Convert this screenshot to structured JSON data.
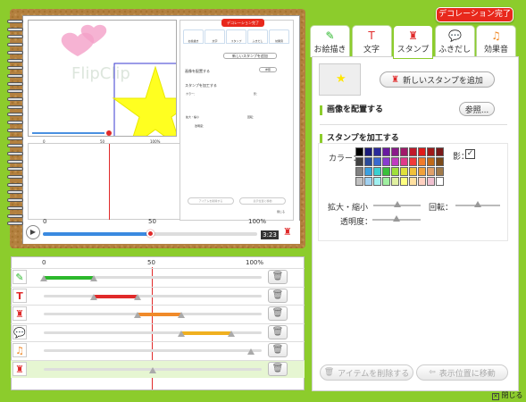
{
  "header": {
    "done_label": "デコレーション完了"
  },
  "preview": {
    "watermark": "FlipClip"
  },
  "tabs": [
    {
      "label": "お絵描き",
      "icon": "pencil-icon"
    },
    {
      "label": "文字",
      "icon": "text-t-icon"
    },
    {
      "label": "スタンプ",
      "icon": "stamp-icon"
    },
    {
      "label": "ふきだし",
      "icon": "speech-bubble-icon"
    },
    {
      "label": "効果音",
      "icon": "music-note-icon"
    }
  ],
  "active_tab": "スタンプ",
  "stamp_panel": {
    "new_stamp_label": "新しいスタンプを追加",
    "place_section": "画像を配置する",
    "browse_label": "参照...",
    "process_section": "スタンプを加工する",
    "color_label": "カラー：",
    "shadow_label": "影：",
    "scale_label": "拡大・縮小",
    "rotate_label": "回転：",
    "opacity_label": "透明度：",
    "shadow_checked": true,
    "scale_value": 0.5,
    "rotate_value": 0.5,
    "opacity_value": 0.5
  },
  "palette": [
    "#000000",
    "#1a1a7a",
    "#2a2a9a",
    "#6a1aa0",
    "#8a1a8a",
    "#a01a6a",
    "#c01a2a",
    "#e01a1a",
    "#a01a1a",
    "#7a1a1a",
    "#404040",
    "#2a4a9a",
    "#3a6ad0",
    "#8a3ad0",
    "#c03ac0",
    "#e03a8a",
    "#f03a3a",
    "#f07a2a",
    "#c06a1a",
    "#7a4a1a",
    "#808080",
    "#3aa0e0",
    "#3ad0d0",
    "#3ac03a",
    "#a0e03a",
    "#e0e03a",
    "#f0c03a",
    "#f0a03a",
    "#e0a06a",
    "#a07a4a",
    "#c0c0c0",
    "#a0d0f0",
    "#a0f0f0",
    "#a0f0a0",
    "#e0f0a0",
    "#ffff80",
    "#ffe0a0",
    "#ffd0c0",
    "#f0c0d0",
    "#ffffff"
  ],
  "actions": {
    "delete_label": "アイテムを削除する",
    "move_label": "表示位置に移動"
  },
  "close_label": "閉じる",
  "timeline": {
    "marks": {
      "start": "0",
      "mid": "50",
      "end": "100%"
    },
    "rows": [
      {
        "icon": "pencil-icon",
        "color": "#2cb82c",
        "start": 0.0,
        "end": 0.23
      },
      {
        "icon": "text-t-icon",
        "color": "#e02a2a",
        "start": 0.23,
        "end": 0.43
      },
      {
        "icon": "stamp-icon",
        "color": "#f08a2a",
        "start": 0.43,
        "end": 0.63
      },
      {
        "icon": "speech-bubble-icon",
        "color": "#f0b020",
        "start": 0.63,
        "end": 0.86
      },
      {
        "icon": "music-note-icon",
        "color": "",
        "start": 0.95,
        "end": 0.95
      },
      {
        "icon": "stamp-icon",
        "color": "",
        "start": 0.5,
        "end": 0.5
      }
    ]
  },
  "player": {
    "time": "3:23",
    "marks": {
      "start": "0",
      "mid": "50",
      "end": "100%"
    },
    "progress": 0.5
  },
  "mini": {
    "new_stamp_label": "新しいスタンプを追加",
    "place_section": "画像を配置する",
    "process_section": "スタンプを加工する",
    "browse_label": "参照",
    "delete_label": "アイテムを削除する",
    "move_label": "表示位置に移動",
    "done_label": "デコレーション完了",
    "close_label": "閉じる",
    "marks": {
      "start": "0",
      "mid": "50",
      "end": "100%"
    }
  }
}
